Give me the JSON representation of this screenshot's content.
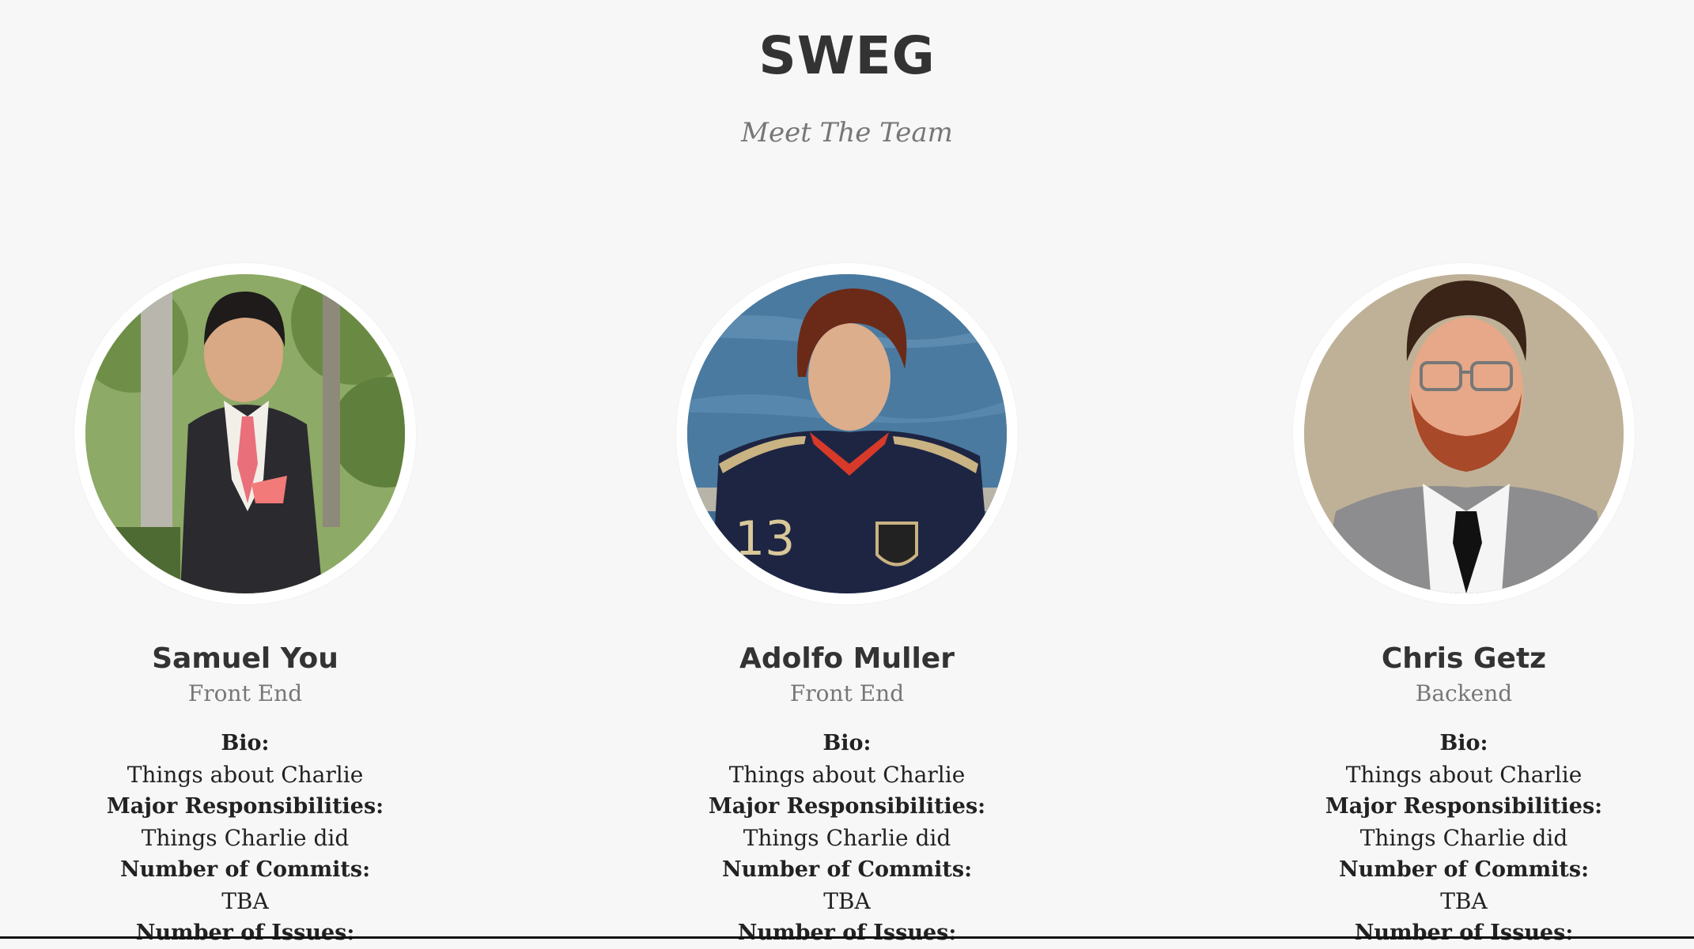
{
  "header": {
    "title": "SWEG",
    "subtitle": "Meet The Team"
  },
  "labels": {
    "bio": "Bio:",
    "responsibilities": "Major Responsibilities:",
    "commits": "Number of Commits:",
    "issues": "Number of Issues:"
  },
  "members": [
    {
      "name": "Samuel You",
      "role": "Front End",
      "bio": "Things about Charlie",
      "responsibilities": "Things Charlie did",
      "commits": "TBA"
    },
    {
      "name": "Adolfo Muller",
      "role": "Front End",
      "bio": "Things about Charlie",
      "responsibilities": "Things Charlie did",
      "commits": "TBA"
    },
    {
      "name": "Chris Getz",
      "role": "Backend",
      "bio": "Things about Charlie",
      "responsibilities": "Things Charlie did",
      "commits": "TBA"
    }
  ]
}
